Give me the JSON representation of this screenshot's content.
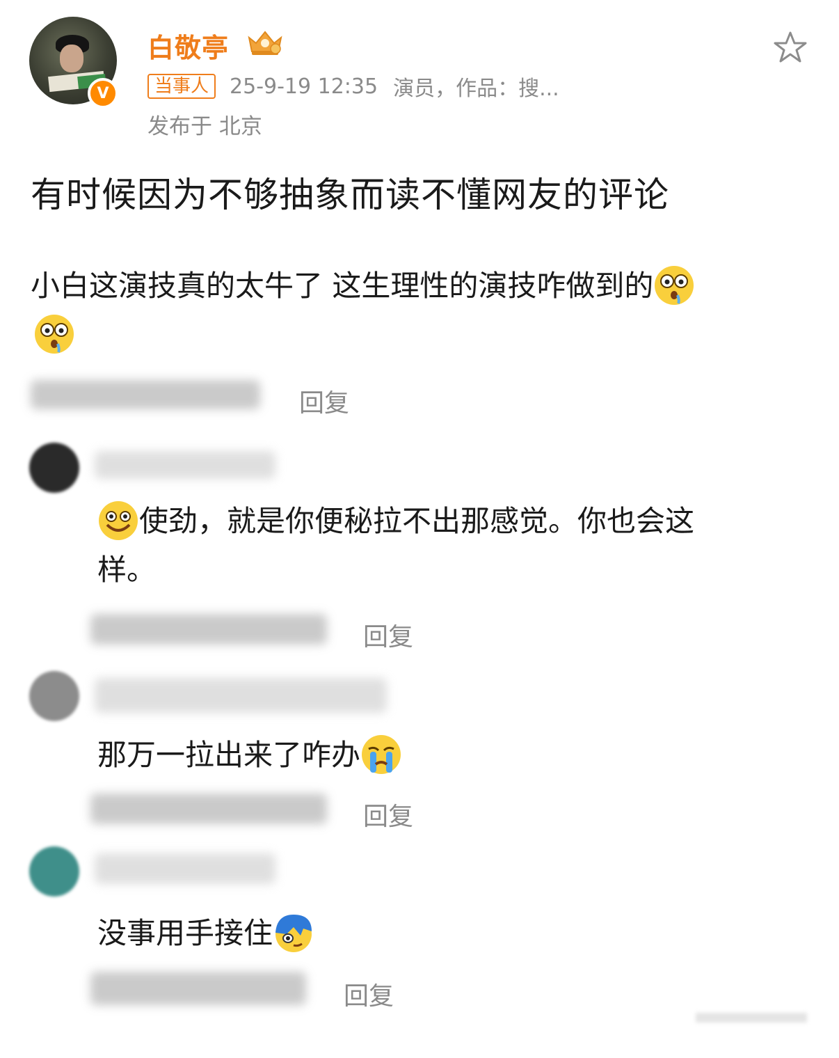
{
  "post": {
    "username": "白敬亭",
    "tag": "当事人",
    "time": "25-9-19 12:35",
    "description": "演员，作品：搜...",
    "location": "发布于 北京",
    "text": "有时候因为不够抽象而读不懂网友的评论"
  },
  "comments": [
    {
      "line1": "小白这演技真的太牛了 这生理性的演技咋做到的",
      "reply": "回复",
      "emoji": "astonished-drool-emoji"
    },
    {
      "line1": "使劲，就是你便秘拉不出那感觉。你也会这",
      "line2": "样。",
      "reply": "回复",
      "emoji": "grin-emoji"
    },
    {
      "line1": "那万一拉出来了咋办",
      "reply": "回复",
      "emoji": "crying-emoji"
    },
    {
      "line1": "没事用手接住",
      "reply": "回复",
      "emoji": "covering-eye-emoji"
    }
  ],
  "colors": {
    "accent": "#ef7d1b",
    "meta_gray": "#8a8a8a",
    "text": "#1a1a1a"
  }
}
